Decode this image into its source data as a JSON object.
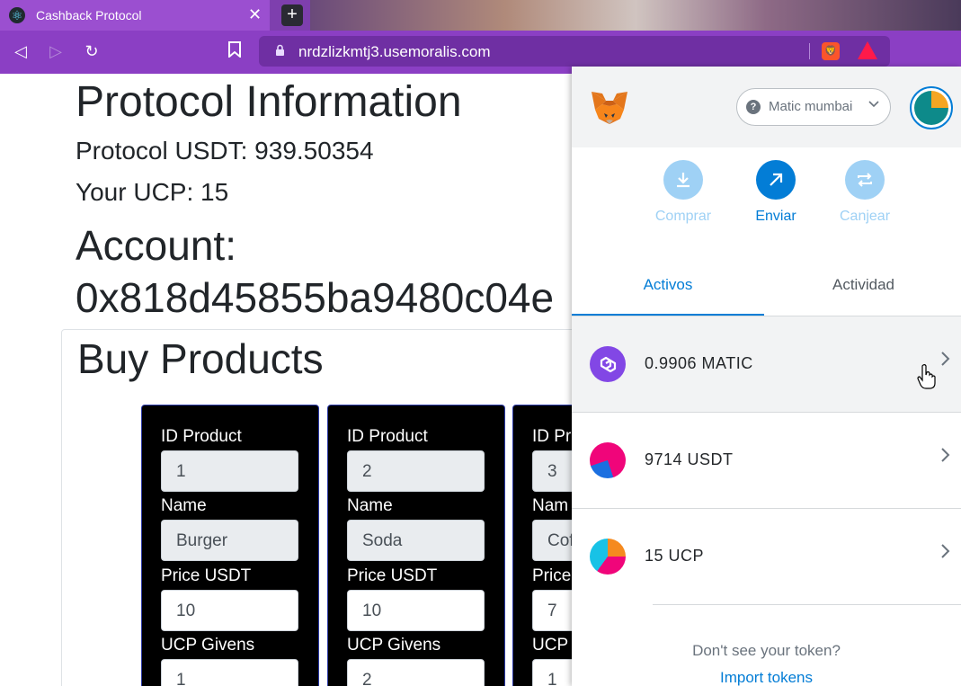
{
  "browser": {
    "tab_title": "Cashback Protocol",
    "tab_close": "✕",
    "new_tab": "+",
    "back": "◁",
    "forward": "▷",
    "reload": "↻",
    "bookmark": "🔖",
    "lock": "🔒",
    "url": "nrdzlizkmtj3.usemoralis.com"
  },
  "page": {
    "title": "Protocol Information",
    "protocol_usdt": "Protocol USDT: 939.50354",
    "your_ucp": "Your UCP: 15",
    "account_label": "Account:",
    "account_address": "0x818d45855ba9480c04e",
    "buy_title": "Buy Products"
  },
  "products": [
    {
      "id_label": "ID Product",
      "id": "1",
      "name_label": "Name",
      "name": "Burger",
      "price_label": "Price USDT",
      "price": "10",
      "ucp_label": "UCP Givens",
      "ucp": "1"
    },
    {
      "id_label": "ID Product",
      "id": "2",
      "name_label": "Name",
      "name": "Soda",
      "price_label": "Price USDT",
      "price": "10",
      "ucp_label": "UCP Givens",
      "ucp": "2"
    },
    {
      "id_label": "ID Pro",
      "id": "3",
      "name_label": "Nam",
      "name": "Cof",
      "price_label": "Price",
      "price": "7",
      "ucp_label": "UCP",
      "ucp": "1"
    }
  ],
  "metamask": {
    "network": "Matic mumbai",
    "actions": [
      {
        "label": "Comprar",
        "icon": "⤓",
        "color": "#9fd1f5",
        "text_color": "#9fd1f5"
      },
      {
        "label": "Enviar",
        "icon": "↗",
        "color": "#037dd6",
        "text_color": "#037dd6"
      },
      {
        "label": "Canjear",
        "icon": "⇄",
        "color": "#9fd1f5",
        "text_color": "#9fd1f5"
      }
    ],
    "tab_assets": "Activos",
    "tab_activity": "Actividad",
    "assets": [
      {
        "label": "0.9906 MATIC",
        "icon": "matic-icon"
      },
      {
        "label": "9714 USDT",
        "icon": "usdt-jazzicon"
      },
      {
        "label": "15 UCP",
        "icon": "ucp-jazzicon"
      }
    ],
    "dont_see": "Don't see your token?",
    "import": "Import tokens"
  },
  "colors": {
    "browser_purple": "#8b3fc4",
    "metamask_blue": "#037dd6",
    "card_bg": "#000000"
  }
}
